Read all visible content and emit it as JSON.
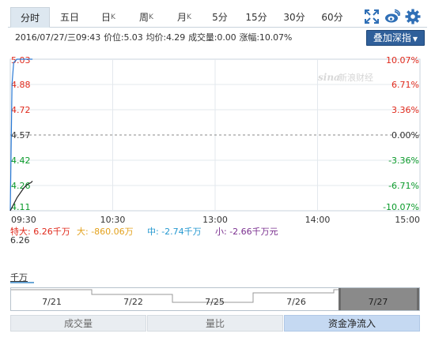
{
  "tabs": [
    {
      "label": "分时",
      "sup": ""
    },
    {
      "label": "五日",
      "sup": ""
    },
    {
      "label": "日",
      "sup": "K"
    },
    {
      "label": "周",
      "sup": "K"
    },
    {
      "label": "月",
      "sup": "K"
    },
    {
      "label": "5分",
      "sup": ""
    },
    {
      "label": "15分",
      "sup": ""
    },
    {
      "label": "30分",
      "sup": ""
    },
    {
      "label": "60分",
      "sup": ""
    }
  ],
  "active_tab": "分时",
  "info": {
    "datetime": "2016/07/27/三09:43",
    "price": "价位:5.03",
    "avg": "均价:4.29",
    "volume": "成交量:0.00",
    "change": "涨幅:10.07%"
  },
  "depth_button": "叠加深指",
  "watermark": "新浪财经",
  "watermark_logo": "sina",
  "legend": {
    "huge": "特大: 6.26千万",
    "large": "大: -860.06万",
    "medium": "中: -2.74千万",
    "small": "小: -2.66千万元"
  },
  "sub_top": "6.26",
  "unit": "千万",
  "dates": [
    "7/21",
    "7/22",
    "7/25",
    "7/26",
    "7/27"
  ],
  "selected_date": "7/27",
  "bottom_tabs": [
    "成交量",
    "量比",
    "资金净流入"
  ],
  "active_bottom_tab": "资金净流入",
  "colors": {
    "up": "#e0291b",
    "down": "#0a9a2a",
    "price_line": "#2a7ad6",
    "avg_line": "#222222",
    "huge": "#e0291b",
    "large": "#e3a11c",
    "medium": "#2598d0",
    "small": "#7a2f8f",
    "accent": "#2f5f9a"
  },
  "chart_data": {
    "type": "line",
    "title": "",
    "x_ticks": [
      "09:30",
      "10:30",
      "13:00",
      "14:00",
      "15:00"
    ],
    "y_left_ticks": [
      "5.03",
      "4.88",
      "4.72",
      "4.57",
      "4.42",
      "4.26",
      "4.11"
    ],
    "y_right_ticks": [
      "10.07%",
      "6.71%",
      "3.36%",
      "0.00%",
      "-3.36%",
      "-6.71%",
      "-10.07%"
    ],
    "base_price": 4.57,
    "ylim": [
      4.11,
      5.03
    ],
    "series": [
      {
        "values": [
          [
            0,
            4.11
          ],
          [
            1,
            4.88
          ],
          [
            2,
            5.01
          ],
          [
            3,
            5.02
          ],
          [
            4,
            5.03
          ],
          [
            5,
            5.03
          ],
          [
            6,
            5.03
          ],
          [
            7,
            5.03
          ],
          [
            8,
            5.03
          ],
          [
            9,
            5.03
          ],
          [
            10,
            5.03
          ],
          [
            11,
            5.03
          ],
          [
            12,
            5.03
          ],
          [
            13,
            5.03
          ]
        ]
      },
      {
        "values": [
          [
            0,
            4.11
          ],
          [
            2,
            4.15
          ],
          [
            4,
            4.19
          ],
          [
            6,
            4.22
          ],
          [
            8,
            4.25
          ],
          [
            10,
            4.27
          ],
          [
            12,
            4.28
          ],
          [
            13,
            4.29
          ]
        ]
      }
    ],
    "x_range_minutes": [
      0,
      240
    ],
    "grid": true
  }
}
